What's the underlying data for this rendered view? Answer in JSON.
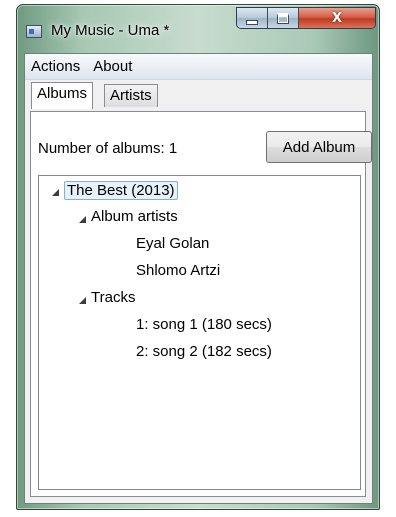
{
  "window": {
    "title": "My Music - Uma *",
    "close_glyph": "X"
  },
  "menu": [
    "Actions",
    "About"
  ],
  "tabs": [
    {
      "label": "Albums",
      "selected": true
    },
    {
      "label": "Artists",
      "selected": false
    }
  ],
  "albums_tab": {
    "count_label": "Number of albums: 1",
    "add_button": "Add Album",
    "tree": {
      "album": "The Best (2013)",
      "artists_group": "Album artists",
      "artists": [
        "Eyal Golan",
        "Shlomo Artzi"
      ],
      "tracks_group": "Tracks",
      "tracks": [
        "1: song 1 (180 secs)",
        "2: song 2 (182 secs)"
      ]
    }
  },
  "colors": {
    "selection_fill": "#e8f2fd",
    "selection_border": "#84acdd",
    "close_button": "#c23a21"
  }
}
